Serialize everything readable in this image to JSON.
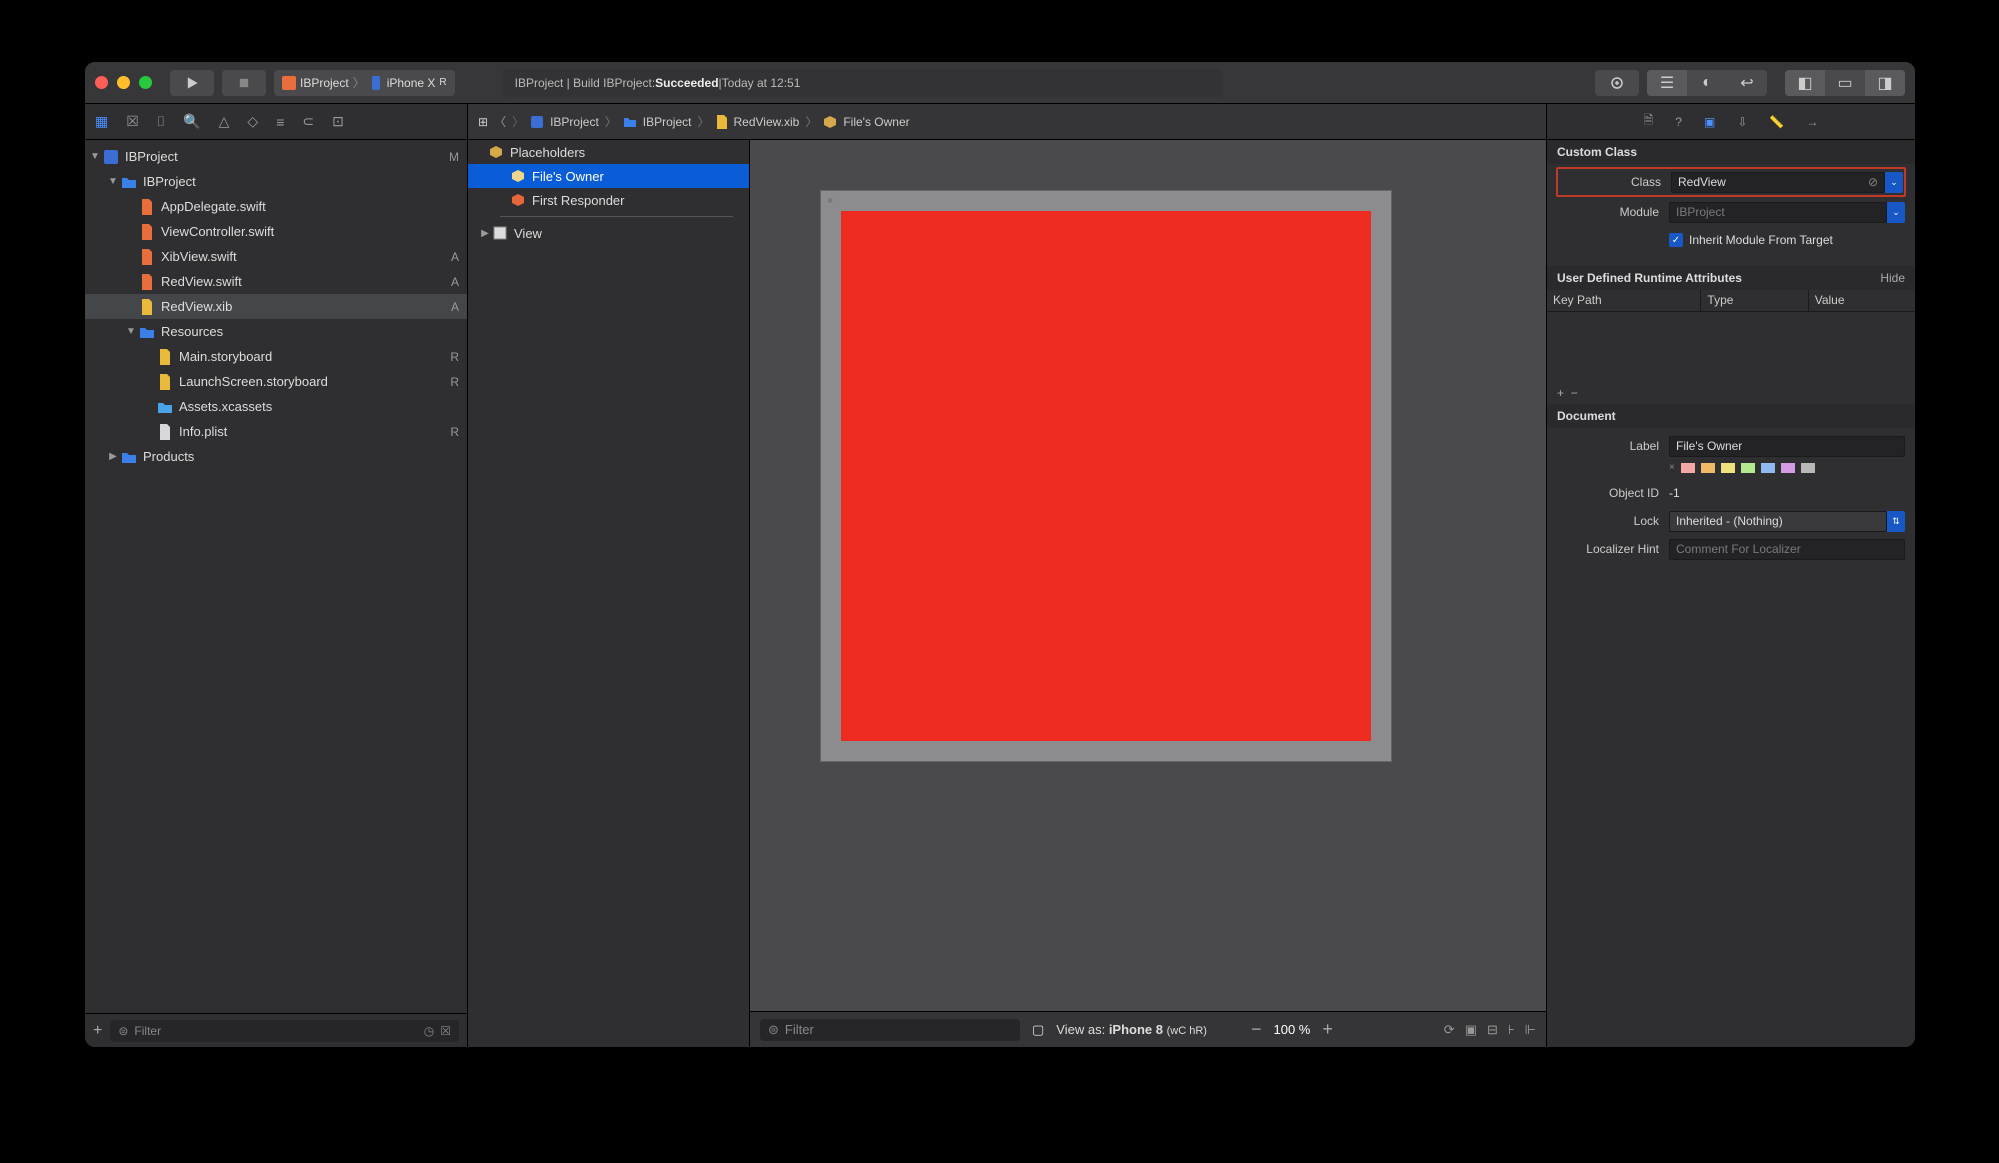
{
  "scheme": {
    "project": "IBProject",
    "device": "iPhone X",
    "device_sub": "R"
  },
  "status": {
    "prefix": "IBProject | Build IBProject: ",
    "result": "Succeeded",
    "sep": " | ",
    "time": "Today at 12:51"
  },
  "project_name": "IBProject",
  "nav": {
    "root": {
      "name": "IBProject",
      "status": "M"
    },
    "group": {
      "name": "IBProject"
    },
    "files": [
      {
        "name": "AppDelegate.swift",
        "status": ""
      },
      {
        "name": "ViewController.swift",
        "status": ""
      },
      {
        "name": "XibView.swift",
        "status": "A"
      },
      {
        "name": "RedView.swift",
        "status": "A"
      },
      {
        "name": "RedView.xib",
        "status": "A",
        "selected": true
      }
    ],
    "res_group": "Resources",
    "resources": [
      {
        "name": "Main.storyboard",
        "status": "R"
      },
      {
        "name": "LaunchScreen.storyboard",
        "status": "R"
      },
      {
        "name": "Assets.xcassets",
        "status": ""
      },
      {
        "name": "Info.plist",
        "status": "R"
      }
    ],
    "products": "Products",
    "filter_placeholder": "Filter"
  },
  "crumbs": [
    "IBProject",
    "IBProject",
    "RedView.xib",
    "File's Owner"
  ],
  "outline": {
    "placeholders": "Placeholders",
    "files_owner": "File's Owner",
    "first_responder": "First Responder",
    "view": "View"
  },
  "canvas": {
    "view_as_prefix": "View as: ",
    "device": "iPhone 8",
    "traits": "(wC hR)",
    "zoom": "100 %"
  },
  "inspector": {
    "custom_class": {
      "title": "Custom Class",
      "class_label": "Class",
      "class_value": "RedView",
      "module_label": "Module",
      "module_placeholder": "IBProject",
      "inherit_label": "Inherit Module From Target"
    },
    "udra": {
      "title": "User Defined Runtime Attributes",
      "hide": "Hide",
      "key_path": "Key Path",
      "type": "Type",
      "value": "Value"
    },
    "document": {
      "title": "Document",
      "label_label": "Label",
      "label_value": "File's Owner",
      "object_id_label": "Object ID",
      "object_id_value": "-1",
      "lock_label": "Lock",
      "lock_value": "Inherited - (Nothing)",
      "localizer_label": "Localizer Hint",
      "localizer_placeholder": "Comment For Localizer"
    },
    "colors": [
      "#f4a8a4",
      "#f0b968",
      "#efe27c",
      "#b4ea8f",
      "#8fb8ef",
      "#d39ce3",
      "#b8b8b8"
    ]
  }
}
